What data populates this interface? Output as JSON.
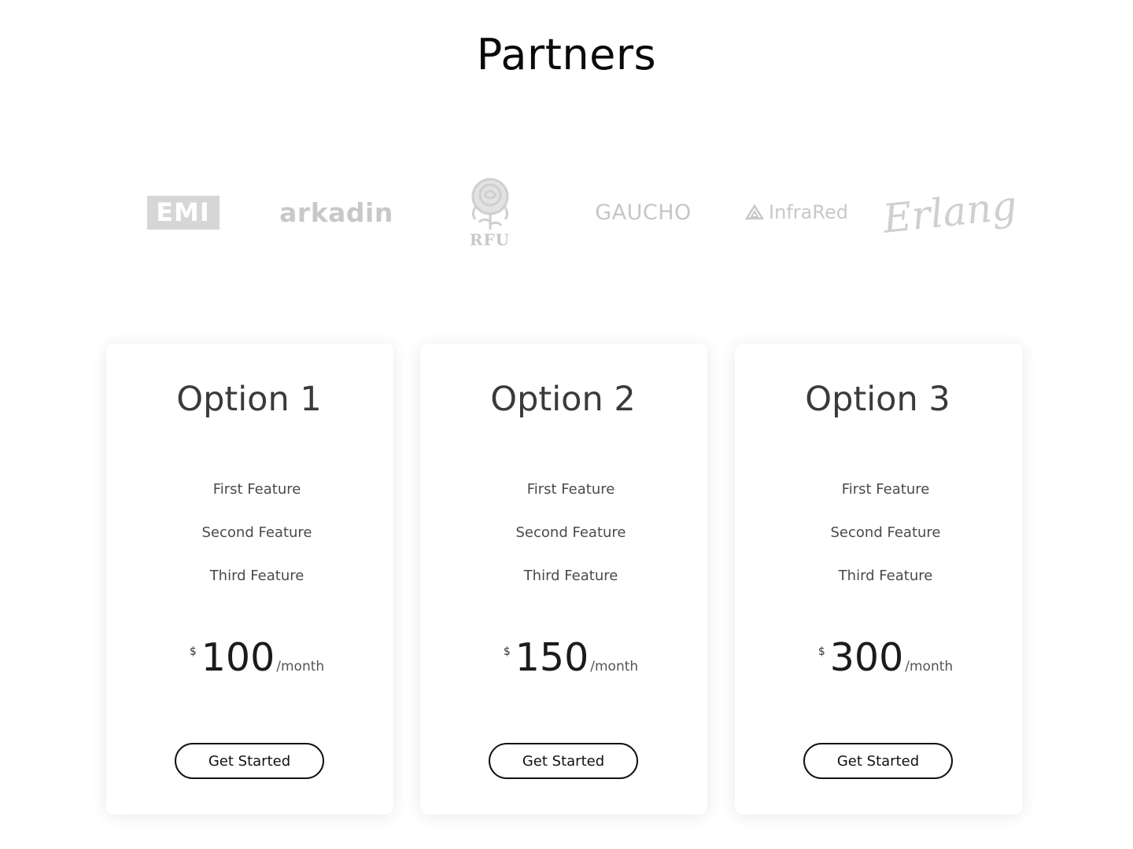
{
  "partners": {
    "title": "Partners",
    "logos": [
      {
        "name": "EMI",
        "icon": "emi-logo"
      },
      {
        "name": "arkadin",
        "icon": "arkadin-logo"
      },
      {
        "name": "RFU",
        "icon": "rfu-rose-logo"
      },
      {
        "name": "GAUCHO",
        "icon": "gaucho-logo"
      },
      {
        "name": "InfraRed",
        "icon": "infrared-logo"
      },
      {
        "name": "Erlang",
        "icon": "erlang-logo"
      }
    ]
  },
  "plans": [
    {
      "title": "Option 1",
      "features": [
        "First Feature",
        "Second Feature",
        "Third Feature"
      ],
      "currency": "$",
      "amount": "100",
      "period": "/month",
      "cta": "Get Started"
    },
    {
      "title": "Option 2",
      "features": [
        "First Feature",
        "Second Feature",
        "Third Feature"
      ],
      "currency": "$",
      "amount": "150",
      "period": "/month",
      "cta": "Get Started"
    },
    {
      "title": "Option 3",
      "features": [
        "First Feature",
        "Second Feature",
        "Third Feature"
      ],
      "currency": "$",
      "amount": "300",
      "period": "/month",
      "cta": "Get Started"
    }
  ],
  "colors": {
    "logo_gray": "#cccccc",
    "title_text": "#0a0a0a",
    "card_title": "#3a3a3a",
    "button_border": "#111111"
  }
}
